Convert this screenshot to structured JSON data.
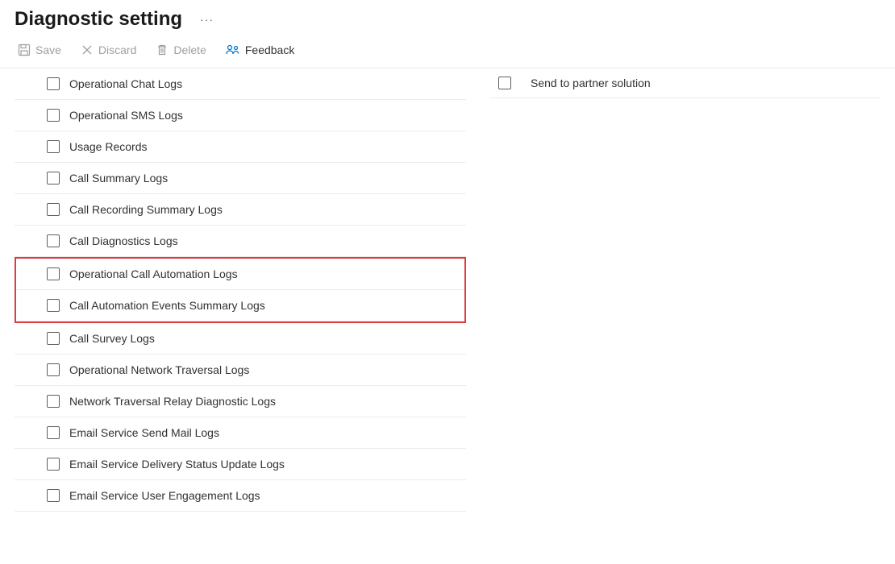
{
  "header": {
    "title": "Diagnostic setting",
    "more_icon": "···"
  },
  "toolbar": {
    "save": "Save",
    "discard": "Discard",
    "delete": "Delete",
    "feedback": "Feedback"
  },
  "logs": [
    {
      "label": "Operational Chat Logs"
    },
    {
      "label": "Operational SMS Logs"
    },
    {
      "label": "Usage Records"
    },
    {
      "label": "Call Summary Logs"
    },
    {
      "label": "Call Recording Summary Logs"
    },
    {
      "label": "Call Diagnostics Logs"
    },
    {
      "label": "Operational Call Automation Logs"
    },
    {
      "label": "Call Automation Events Summary Logs"
    },
    {
      "label": "Call Survey Logs"
    },
    {
      "label": "Operational Network Traversal Logs"
    },
    {
      "label": "Network Traversal Relay Diagnostic Logs"
    },
    {
      "label": "Email Service Send Mail Logs"
    },
    {
      "label": "Email Service Delivery Status Update Logs"
    },
    {
      "label": "Email Service User Engagement Logs"
    }
  ],
  "highlighted_indices": [
    6,
    7
  ],
  "destinations": [
    {
      "label": "Send to partner solution"
    }
  ]
}
